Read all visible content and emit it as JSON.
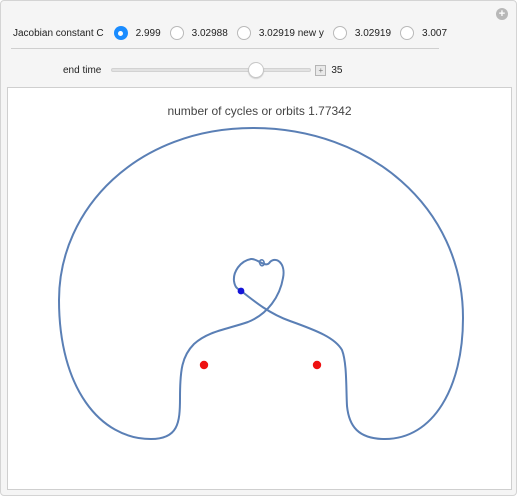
{
  "controls": {
    "jacobian_label": "Jacobian constant C",
    "options": [
      "2.999",
      "3.02988",
      "3.02919 new y",
      "3.02919",
      "3.007"
    ],
    "selected_index": 0,
    "end_time_label": "end time",
    "end_time_value": "35",
    "end_time_fraction": 0.74
  },
  "plot": {
    "title": "number of cycles or orbits 1.77342",
    "orbit_color": "#5a7fb5",
    "primary_color": "#ee1111",
    "body_color": "#1414d8"
  }
}
